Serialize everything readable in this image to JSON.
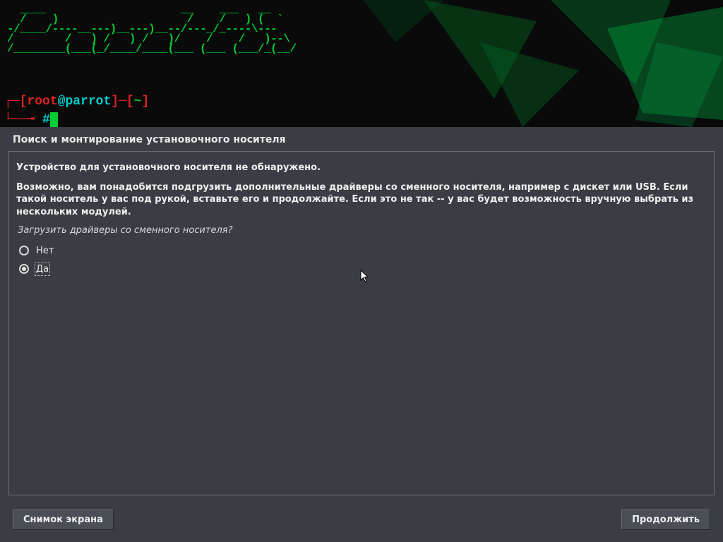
{
  "banner": {
    "ascii": "  ____                     __    ___   __\n  /    )                    /    /   ) (  `\n-/____/----__---)__---)__--/---_/_----\\---\n/        /   ) /   ) /   )/    /    /   )--\\\n/________(___(_/____/____(___ (___ (___/_(__/",
    "prompt_user": "root",
    "prompt_at": "@",
    "prompt_host": "parrot",
    "prompt_path": "~",
    "prompt_hash": "#"
  },
  "page": {
    "title": "Поиск и монтирование установочного носителя",
    "heading": "Устройство для установочного носителя не обнаружено.",
    "body": "Возможно, вам понадобится подгрузить дополнительные драйверы со сменного носителя, например с дискет или USB. Если такой носитель у вас под рукой, вставьте его и продолжайте. Если это не так -- у вас будет возможность вручную выбрать из нескольких модулей.",
    "question": "Загрузить драйверы со сменного носителя?"
  },
  "options": {
    "no": "Нет",
    "yes": "Да",
    "selected": "yes"
  },
  "buttons": {
    "screenshot": "Снимок экрана",
    "continue": "Продолжить"
  }
}
